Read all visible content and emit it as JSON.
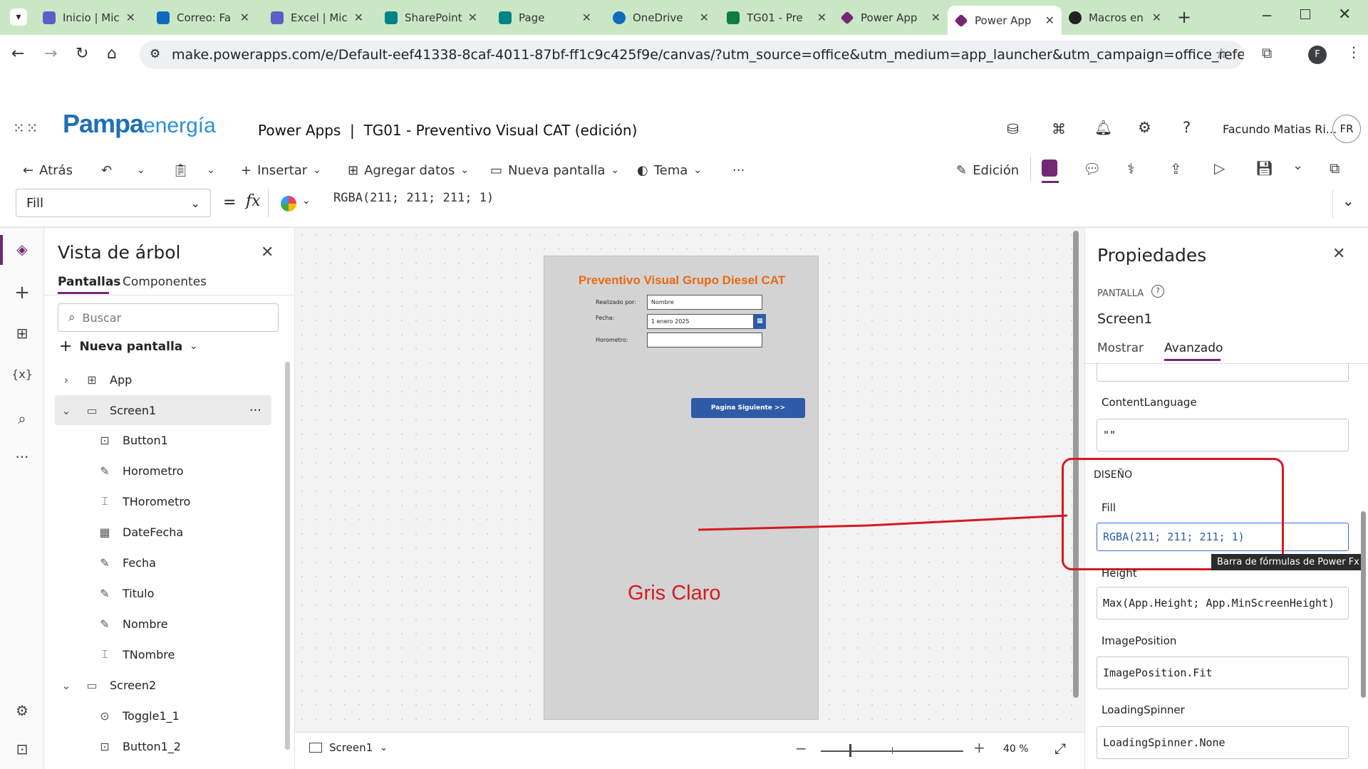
{
  "browser": {
    "tabs": [
      {
        "title": "Inicio | Mic",
        "color": "#5b5fc7"
      },
      {
        "title": "Correo: Fa",
        "color": "#0f6cbd"
      },
      {
        "title": "Excel | Mic",
        "color": "#5b5fc7"
      },
      {
        "title": "SharePoint",
        "color": "#038387"
      },
      {
        "title": "Page",
        "color": "#038387"
      },
      {
        "title": "OneDrive",
        "color": "#0f6cbd"
      },
      {
        "title": "TG01 - Pre",
        "color": "#107c41"
      },
      {
        "title": "Power App",
        "color": "#742774"
      },
      {
        "title": "Power App",
        "color": "#742774"
      },
      {
        "title": "Macros en",
        "color": "#222222"
      }
    ],
    "url": "make.powerapps.com/e/Default-eef41338-8caf-4011-87bf-ff1c9c425f9e/canvas/?utm_source=office&utm_medium=app_launcher&utm_campaign=office_referrals&action=edit&form-fa...",
    "profile_initial": "F"
  },
  "header": {
    "logo_main": "Pampa",
    "logo_sub": "energía",
    "app_title": "Power Apps  |  TG01 - Preventivo Visual CAT (edición)",
    "user_name": "Facundo Matias Ri...",
    "user_initials": "FR"
  },
  "commands": {
    "back": "Atrás",
    "insert": "Insertar",
    "add_data": "Agregar datos",
    "new_screen": "Nueva pantalla",
    "theme": "Tema",
    "more": "···",
    "edit": "Edición"
  },
  "formula_bar": {
    "property": "Fill",
    "equals": "=",
    "fx": "fx",
    "formula": "RGBA(211; 211; 211; 1)"
  },
  "tree": {
    "title": "Vista de árbol",
    "tab_screens": "Pantallas",
    "tab_components": "Componentes",
    "search_placeholder": "Buscar",
    "new_screen": "Nueva pantalla",
    "items": [
      {
        "label": "App",
        "icon": "app-icon"
      },
      {
        "label": "Screen1",
        "icon": "screen-icon"
      },
      {
        "label": "Button1",
        "icon": "button-icon"
      },
      {
        "label": "Horometro",
        "icon": "edit-icon"
      },
      {
        "label": "THorometro",
        "icon": "textinput-icon"
      },
      {
        "label": "DateFecha",
        "icon": "calendar-icon"
      },
      {
        "label": "Fecha",
        "icon": "edit-icon"
      },
      {
        "label": "Titulo",
        "icon": "edit-icon"
      },
      {
        "label": "Nombre",
        "icon": "edit-icon"
      },
      {
        "label": "TNombre",
        "icon": "textinput-icon"
      },
      {
        "label": "Screen2",
        "icon": "screen-icon"
      },
      {
        "label": "Toggle1_1",
        "icon": "toggle-icon"
      },
      {
        "label": "Button1_2",
        "icon": "button-icon"
      }
    ]
  },
  "canvas": {
    "screen_title": "Preventivo Visual Grupo Diesel CAT",
    "label_realizado": "Realizado por:",
    "input_nombre": "Nombre",
    "label_fecha": "Fecha:",
    "date_value": "1 enero 2025",
    "label_horometro": "Horometro:",
    "button_next": "Pagina Siguiente >>",
    "annotation": "Gris Claro",
    "screen_selector": "Screen1",
    "zoom": "40",
    "zoom_unit": "%"
  },
  "properties": {
    "title": "Propiedades",
    "section": "PANTALLA",
    "screen_name": "Screen1",
    "tab_show": "Mostrar",
    "tab_advanced": "Avanzado",
    "content_language_label": "ContentLanguage",
    "content_language_value": "\"\"",
    "design_header": "DISEÑO",
    "fill_label": "Fill",
    "fill_value": "RGBA(211; 211; 211; 1)",
    "tooltip": "Barra de fórmulas de Power Fx",
    "height_label": "Height",
    "height_value": "Max(App.Height; App.MinScreenHeight)",
    "image_position_label": "ImagePosition",
    "image_position_value": "ImagePosition.Fit",
    "loading_spinner_label": "LoadingSpinner",
    "loading_spinner_value": "LoadingSpinner.None"
  },
  "colors": {
    "accent": "#742774",
    "screen_fill": "#d3d3d3",
    "title_orange": "#e86a10",
    "annotation_red": "#d71920",
    "button_blue": "#2e5aa8"
  }
}
